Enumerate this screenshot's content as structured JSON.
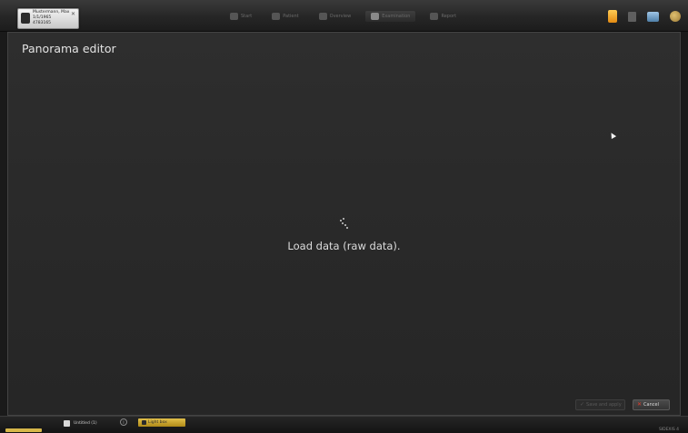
{
  "patient": {
    "name": "Mustermann, Max",
    "dob": "1/1/1965",
    "id": "4783165"
  },
  "nav": {
    "tabs": [
      {
        "label": "Start",
        "active": false
      },
      {
        "label": "Patient",
        "active": false
      },
      {
        "label": "Overview",
        "active": false
      },
      {
        "label": "Examination",
        "active": true
      },
      {
        "label": "Report",
        "active": false
      }
    ]
  },
  "header_icons": [
    "folder-icon",
    "trash-icon",
    "monitor-icon",
    "globe-icon"
  ],
  "main": {
    "title": "Panorama editor",
    "status_text": "Load data (raw data)."
  },
  "buttons": {
    "apply_label": "Save and apply",
    "cancel_label": "Cancel"
  },
  "bottom": {
    "document_label": "Untitled (1)",
    "info_symbol": "i",
    "light_tab_label": "Light box",
    "version": "SIDEXIS 4"
  },
  "colors": {
    "accent_yellow": "#d6b74a",
    "cancel_x": "#e53a2a",
    "background": "#2a2a2a"
  }
}
